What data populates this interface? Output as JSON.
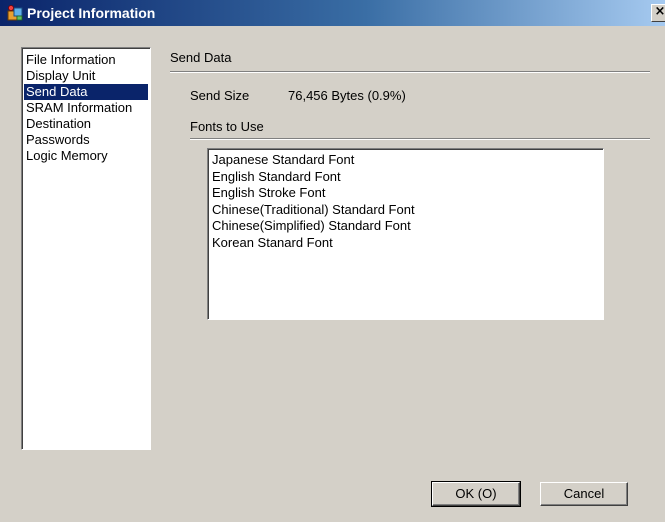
{
  "window": {
    "title": "Project Information",
    "close_glyph": "×",
    "title_icon": "project-info-icon"
  },
  "sidebar": {
    "items": [
      {
        "label": "File Information"
      },
      {
        "label": "Display Unit"
      },
      {
        "label": "Send Data",
        "selected": true
      },
      {
        "label": "SRAM Information"
      },
      {
        "label": "Destination"
      },
      {
        "label": "Passwords"
      },
      {
        "label": "Logic Memory"
      }
    ]
  },
  "main": {
    "section_title": "Send Data",
    "send_size_label": "Send Size",
    "send_size_value": "76,456 Bytes (0.9%)",
    "fonts_section_title": "Fonts to Use",
    "fonts": [
      "Japanese Standard Font",
      "English Standard Font",
      "English Stroke Font",
      "Chinese(Traditional) Standard Font",
      "Chinese(Simplified) Standard Font",
      "Korean Stanard Font"
    ]
  },
  "buttons": {
    "ok_label": "OK (O)",
    "cancel_label": "Cancel"
  },
  "colors": {
    "titlebar_start": "#0a246a",
    "titlebar_end": "#a6caf0",
    "selection": "#0a246a",
    "dialog_face": "#d4d0c8"
  }
}
